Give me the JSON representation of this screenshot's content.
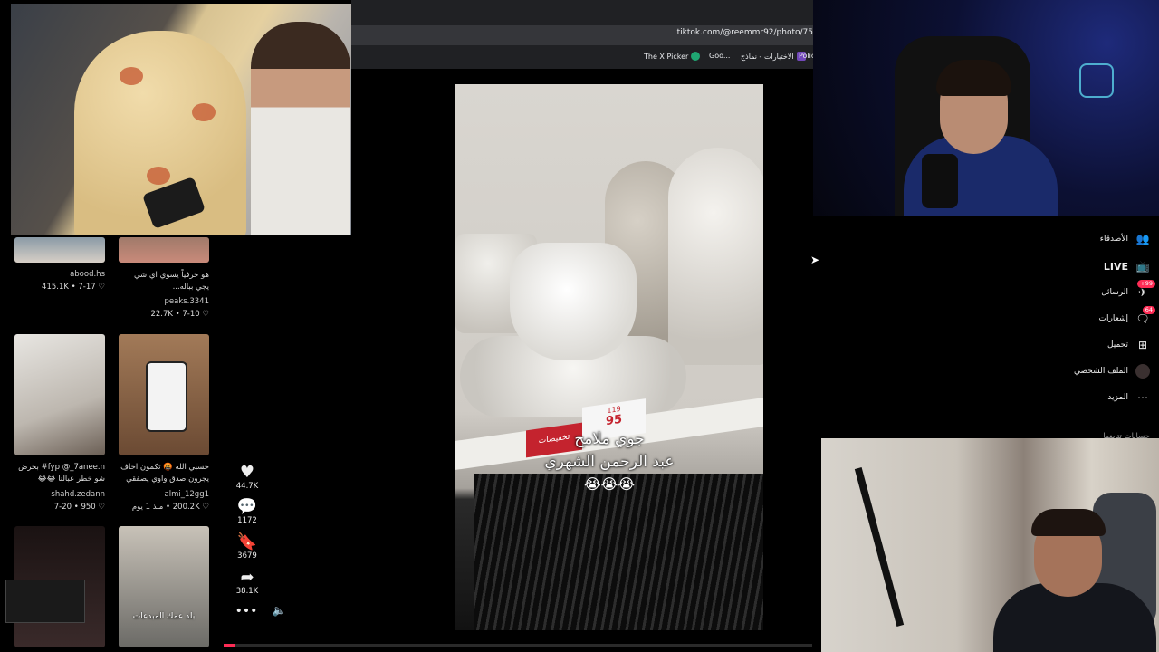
{
  "browser": {
    "url": "tiktok.com/@reemmr92/photo/75",
    "bookmarks": [
      {
        "label": "The X Picker",
        "icon": "x-picker-icon",
        "color": "#1fa672"
      },
      {
        "label": "Goo...",
        "icon": "google-icon",
        "color": "#ffffff"
      },
      {
        "label": "الاختبارات - نماذج",
        "icon": "forms-icon",
        "color": "#7248b9"
      },
      {
        "label": "Polic",
        "icon": "policy-icon",
        "color": "#3b6ed8"
      }
    ]
  },
  "feed": [
    {
      "user": "abood.hs",
      "date": "7-17",
      "likes": "415.1K",
      "caption": ""
    },
    {
      "user": "peaks.3341",
      "date": "7-10",
      "likes": "22.7K",
      "caption": "هو حرفياً يسوي اي شي يجي بباله..."
    },
    {
      "user": "shahd.zedann",
      "date": "7-20",
      "likes": "950",
      "caption": "fyp @_7anee.n# بحرض شو خطر عبالنا 😂😂"
    },
    {
      "user": "almi_12gg1",
      "date": "منذ 1 يوم",
      "likes": "200.2K",
      "caption": "حسبي الله 🤬 تكمون اخاف يجرون صدق واوي يصفقي"
    },
    {
      "user": "",
      "date": "",
      "likes": "",
      "caption": ""
    },
    {
      "user": "",
      "date": "",
      "likes": "",
      "caption": "بلد عمك المبدعات"
    }
  ],
  "video": {
    "caption_line1": "جوي ملامح",
    "caption_line2": "عبد الرحمن الشهري",
    "emoji": "😭😭😭",
    "sale_tag": "تخفيضات",
    "price_old": "119",
    "price_new": "95",
    "progress": 0.02
  },
  "actions": {
    "likes": "44.7K",
    "comments": "1172",
    "saves": "3679",
    "shares": "38.1K"
  },
  "nav": {
    "friends": "الأصدقاء",
    "live": "LIVE",
    "messages": "الرسائل",
    "messages_badge": "99+",
    "notifications": "إشعارات",
    "notifications_badge": "64",
    "upload": "تحميل",
    "profile": "الملف الشخصي",
    "more": "المزيد",
    "following": "حسابات تتابعها"
  },
  "colors": {
    "accent": "#fe2c55"
  }
}
